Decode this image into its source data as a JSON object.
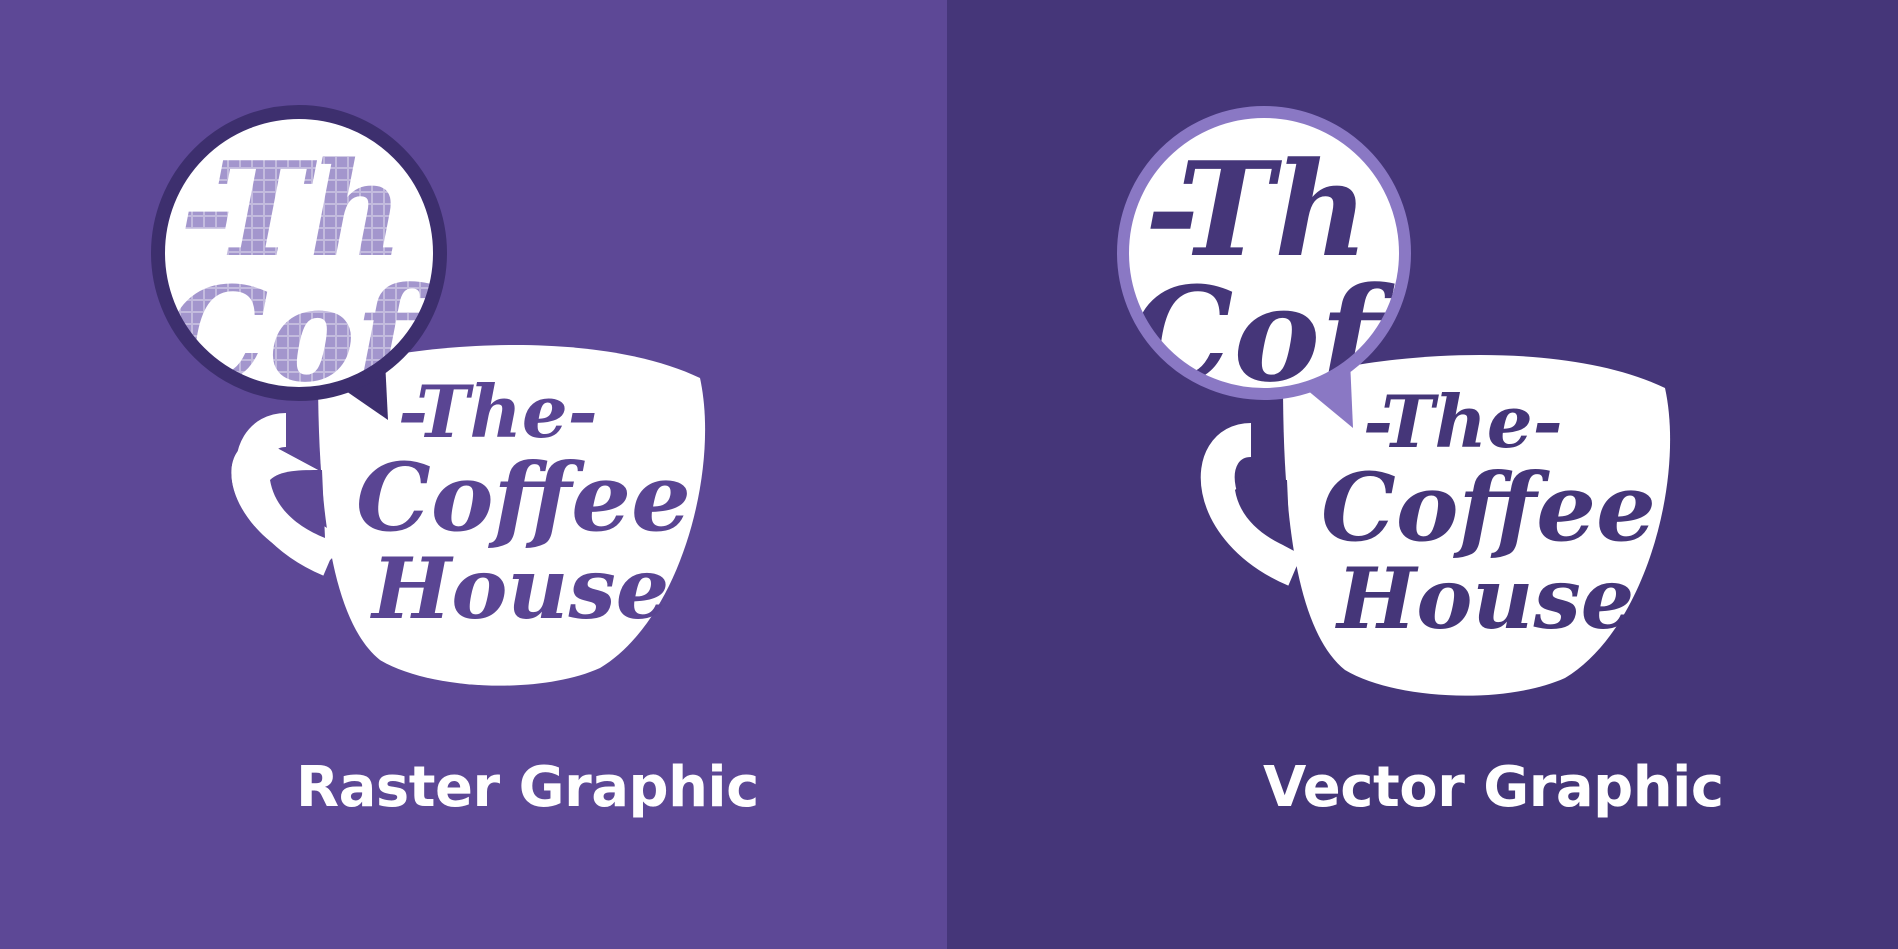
{
  "logo": {
    "line1": "-The-",
    "line2": "Coffee",
    "line3": "House",
    "zoom_line1": "-Th",
    "zoom_line2": "Coff"
  },
  "panels": [
    {
      "caption": "Raster Graphic"
    },
    {
      "caption": "Vector Graphic"
    }
  ],
  "colors": {
    "left_background": "#5d4896",
    "right_background": "#453679",
    "cup": "#ffffff",
    "logo_text": "#5a4593",
    "left_magnifier_ring": "#3d2f6e",
    "right_magnifier_ring": "#8a78c4"
  }
}
